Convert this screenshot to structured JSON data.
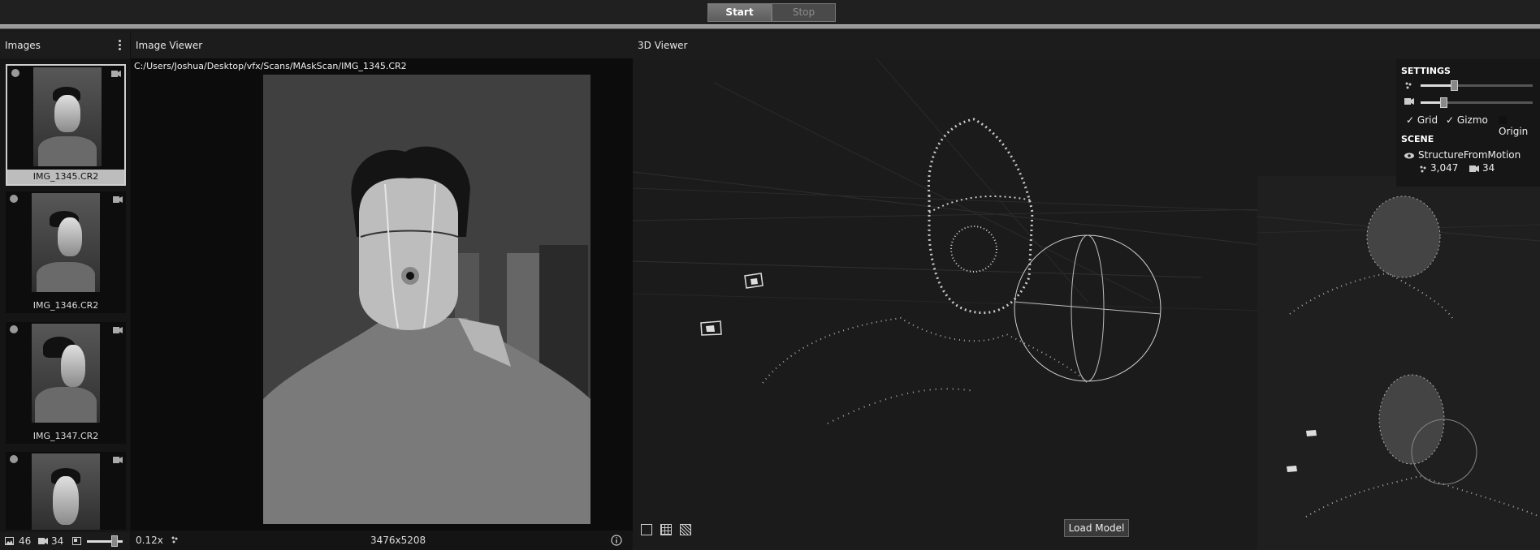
{
  "toolbar": {
    "start_label": "Start",
    "stop_label": "Stop"
  },
  "images_panel": {
    "title": "Images",
    "thumbnails": [
      {
        "name": "IMG_1345.CR2",
        "selected": true
      },
      {
        "name": "IMG_1346.CR2",
        "selected": false
      },
      {
        "name": "IMG_1347.CR2",
        "selected": false
      },
      {
        "name": "",
        "selected": false
      }
    ],
    "footer": {
      "image_count": "46",
      "camera_count": "34"
    }
  },
  "image_viewer": {
    "title": "Image Viewer",
    "path": "C:/Users/Joshua/Desktop/vfx/Scans/MAskScan/IMG_1345.CR2",
    "zoom": "0.12x",
    "resolution": "3476x5208"
  },
  "viewer_3d": {
    "title": "3D Viewer",
    "load_model_label": "Load Model",
    "settings": {
      "title": "SETTINGS",
      "point_size_level": 0.3,
      "camera_scale_level": 0.2,
      "grid_label": "Grid",
      "grid_checked": true,
      "gizmo_label": "Gizmo",
      "gizmo_checked": true,
      "origin_label": "Origin",
      "origin_checked": false,
      "check_mark": "✓"
    },
    "scene": {
      "title": "SCENE",
      "node_name": "StructureFromMotion",
      "point_count": "3,047",
      "camera_count": "34"
    }
  },
  "colors": {
    "accent": "#bdbdbd",
    "panel_bg": "#151515",
    "toolbar_bg": "#202020"
  },
  "icons": [
    "menu-dots-icon",
    "flag-icon",
    "camera-icon",
    "image-icon",
    "points-icon",
    "info-icon",
    "eye-icon",
    "wireframe-icon",
    "grid-view-icon",
    "textured-view-icon"
  ]
}
